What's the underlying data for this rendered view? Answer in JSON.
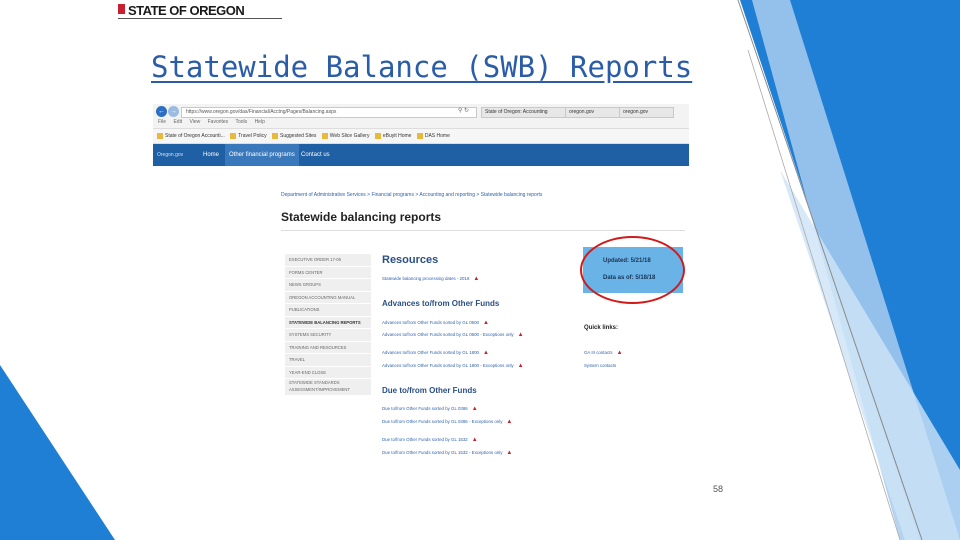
{
  "slide": {
    "title": "Statewide Balance (SWB) Reports",
    "page_number": "58",
    "logo_text": "STATE OF OREGON",
    "accent_color": "#2a5ca8",
    "decor_colors": [
      "#1f7fd4",
      "#b7d7f2"
    ]
  },
  "browser": {
    "url": "https://www.oregon.gov/das/Financial/Acctng/Pages/Balancing.aspx",
    "tabs": [
      "State of Oregon: Accounting",
      "oregon.gov",
      "oregon.gov"
    ],
    "menus": [
      "File",
      "Edit",
      "View",
      "Favorites",
      "Tools",
      "Help"
    ],
    "favorites": [
      "State of Oregon Accounti...",
      "Travel Policy",
      "Suggested Sites",
      "Web Slice Gallery",
      "eBuyit Home",
      "DAS Home"
    ]
  },
  "site_nav": {
    "logo": "Oregon.gov",
    "items": [
      "Home",
      "Other financial programs",
      "Contact us"
    ]
  },
  "page": {
    "breadcrumb": "Department of Administrative Services > Financial programs > Accounting and reporting > Statewide balancing reports",
    "heading": "Statewide balancing reports",
    "left_nav": [
      "EXECUTIVE ORDER 17-06",
      "FORMS CENTER",
      "NEWS GROUPS",
      "OREGON ACCOUNTING MANUAL",
      "PUBLICATIONS",
      "STATEWIDE BALANCING REPORTS",
      "SYSTEMS SECURITY",
      "TRAINING AND RESOURCES",
      "TRAVEL",
      "YEAR-END CLOSE",
      "STATEWIDE STANDARDS ASSESSMENT/IMPROVEMENT"
    ],
    "resources_heading": "Resources",
    "resources_intro": "Statewide balancing processing dates - 2018",
    "advances_heading": "Advances to/from Other Funds",
    "advances_links": [
      "Advances to/from Other Funds sorted by GL 0500",
      "Advances to/from Other Funds sorted by GL 0500 - Exceptions only",
      "Advances to/from Other Funds sorted by GL 1800",
      "Advances to/from Other Funds sorted by GL 1800 - Exceptions only"
    ],
    "due_heading": "Due to/from Other Funds",
    "due_links": [
      "Due to/from Other Funds sorted by GL 0386",
      "Due to/from Other Funds sorted by GL 0386 - Exceptions only",
      "Due to/from Other Funds sorted by GL 1532",
      "Due to/from Other Funds sorted by GL 1532 - Exceptions only"
    ],
    "updated": "Updated: 5/21/18",
    "data_as_of": "Data as of: 5/18/18",
    "quick_links_heading": "Quick links:",
    "quick_links": [
      "GA III contacts",
      "System contacts"
    ]
  }
}
